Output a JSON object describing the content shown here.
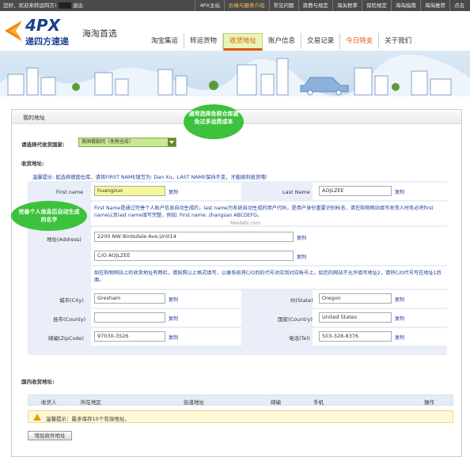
{
  "topbar": {
    "welcome": "您好，欢迎来转运四方!",
    "logout": "退出",
    "links": [
      "4PX主站",
      "价格与服务介绍",
      "常见问题",
      "资费与规定",
      "海关税率",
      "保险规定",
      "海淘指南",
      "海淘推荐",
      "点击"
    ]
  },
  "header": {
    "brand": "4PX",
    "brand_sub": "递四方速递",
    "slogan": "海淘首选",
    "nav": [
      "淘宝集运",
      "转运货物",
      "收货地址",
      "账户信息",
      "交易记录",
      "今日特支",
      "关于我们"
    ]
  },
  "section": {
    "title": "我的地址",
    "country_label": "请选择代收货国家:",
    "country_value": "美国俄勒冈（免税仓库）",
    "address_label": "收货地址:",
    "tip": "温馨提示: 如选择德国仓库，请将FIRST NAME填写为: Dan Xu，LAST NAME保持不变，才能顺利收货哦!",
    "first_name_label": "First name",
    "first_name_value": "huangzuo",
    "last_name_label": "Last Name",
    "last_name_value": "AOJLZEE",
    "copy": "复制",
    "notice1": "First Name是通过完善个人账户信息自动生成的，last name为系统自动生成的用户代码，是用户身份重要识别标志，请在购物网站填写收货人时务必将first name以及last name填写完整，例如: First name: zhangsan ABCDEFG。",
    "address_field_label": "地址(Address)",
    "address1": "2200 NW Birdsdale Ave,Unit14",
    "address2": "C/O  AOJLZEE",
    "notice2": "如在购物网站上的收货地址有两栏，请按照以上格式填写，以便系统将C/O后的代号对应到对应帐号上。如您的网站不允许填写地址2，请将C/O代号写在地址1后面。",
    "city_label": "城市(City)",
    "city_value": "Gresham",
    "state_label": "州(State)",
    "state_value": "Oregon",
    "county_label": "县市(County)",
    "county_value": "",
    "country2_label": "国家(Country)",
    "country2_value": "United States",
    "zip_label": "邮编(ZipCode)",
    "zip_value": "97030-3526",
    "tel_label": "电话(Tel)",
    "tel_value": "503-328-8376"
  },
  "domestic": {
    "title": "国内收货地址:",
    "columns": [
      "收货人",
      "所在地区",
      "街道地址",
      "邮编",
      "手机",
      "操作"
    ],
    "notice": "温馨提示：最多保存10个有效地址。",
    "add_button": "增加收件地址"
  },
  "annotations": {
    "bubble1": "通常选择免税仓库避免过多运费成本",
    "bubble2": "完善个人信息后自动生成的名字"
  },
  "watermark": "Meidebi.com",
  "colors": {
    "accent": "#e05a00",
    "brand": "#1a3f8f",
    "bubble": "#3cc23c"
  }
}
